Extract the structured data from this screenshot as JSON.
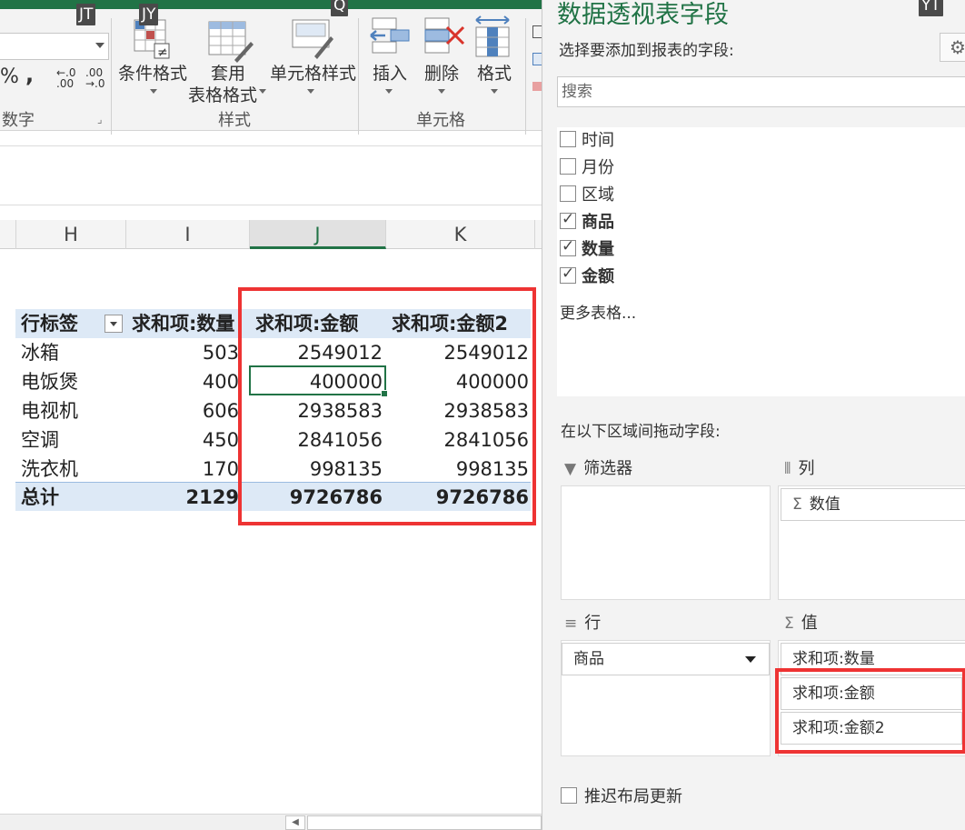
{
  "keytips": [
    "JT",
    "JY",
    "Q",
    "YT"
  ],
  "ribbon": {
    "number_format_symbols": {
      "percent": "%",
      "comma": ",",
      "increase_decimal": "←.0\n.00",
      "decrease_decimal": ".00\n→.0"
    },
    "number_group_label": "数字",
    "conditional_format": "条件格式",
    "format_as_table_line1": "套用",
    "format_as_table_line2": "表格格式",
    "cell_styles": "单元格样式",
    "styles_group_label": "样式",
    "insert": "插入",
    "delete": "删除",
    "format": "格式",
    "cells_group_label": "单元格"
  },
  "columns": [
    "H",
    "I",
    "J",
    "K"
  ],
  "pivot": {
    "headers": [
      "行标签",
      "求和项:数量",
      "求和项:金额",
      "求和项:金额2"
    ],
    "rows": [
      {
        "label": "冰箱",
        "qty": "503",
        "amount": "2549012",
        "amount2": "2549012"
      },
      {
        "label": "电饭煲",
        "qty": "400",
        "amount": "400000",
        "amount2": "400000"
      },
      {
        "label": "电视机",
        "qty": "606",
        "amount": "2938583",
        "amount2": "2938583"
      },
      {
        "label": "空调",
        "qty": "450",
        "amount": "2841056",
        "amount2": "2841056"
      },
      {
        "label": "洗衣机",
        "qty": "170",
        "amount": "998135",
        "amount2": "998135"
      }
    ],
    "total": {
      "label": "总计",
      "qty": "2129",
      "amount": "9726786",
      "amount2": "9726786"
    }
  },
  "pane": {
    "title": "数据透视表字段",
    "subtitle": "选择要添加到报表的字段:",
    "gear_icon": "gear-icon",
    "search_placeholder": "搜索",
    "fields": [
      {
        "name": "时间",
        "checked": false
      },
      {
        "name": "月份",
        "checked": false
      },
      {
        "name": "区域",
        "checked": false
      },
      {
        "name": "商品",
        "checked": true
      },
      {
        "name": "数量",
        "checked": true
      },
      {
        "name": "金额",
        "checked": true
      }
    ],
    "more_tables": "更多表格...",
    "drag_label": "在以下区域间拖动字段:",
    "areas": {
      "filters": "筛选器",
      "columns": "列",
      "rows": "行",
      "values": "值"
    },
    "column_items": [
      "数值"
    ],
    "row_items": [
      "商品"
    ],
    "value_items": [
      "求和项:数量",
      "求和项:金额",
      "求和项:金额2"
    ],
    "defer_update": "推迟布局更新"
  },
  "colors": {
    "accent": "#217346",
    "highlight": "#ee3333",
    "pivot_header": "#dde9f6"
  }
}
